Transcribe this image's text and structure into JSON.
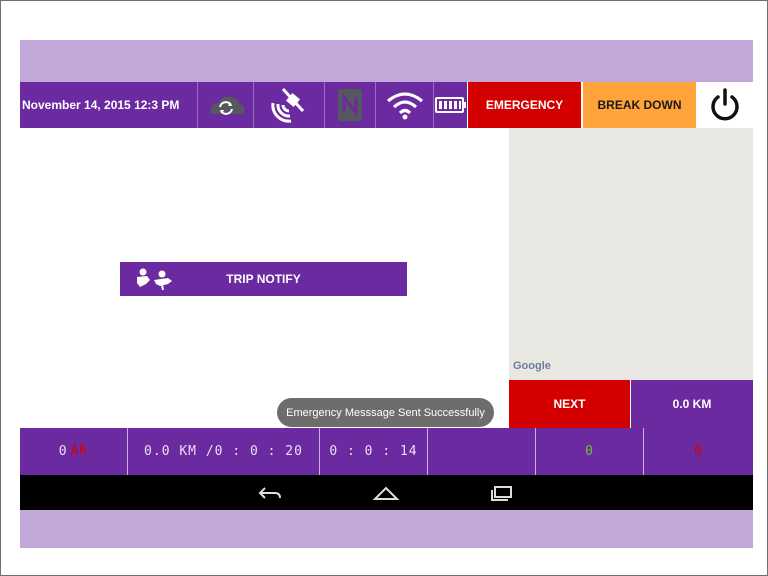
{
  "header": {
    "datetime": "November 14, 2015 12:3 PM",
    "icons": [
      "sync-icon",
      "satellite-icon",
      "nfc-icon",
      "wifi-icon",
      "battery-icon"
    ],
    "emergency_label": "EMERGENCY",
    "breakdown_label": "BREAK DOWN",
    "power_icon": "power-icon"
  },
  "map": {
    "attribution": "Google"
  },
  "trip": {
    "label": "TRIP NOTIFY",
    "icon": "trip-notify-icon"
  },
  "actions": {
    "next_label": "NEXT",
    "distance_label": "0.0 KM"
  },
  "toast": {
    "message": "Emergency Messsage Sent Successfully"
  },
  "status": {
    "cell1_value": "0",
    "cell1_unit": "AR",
    "cell2": "0.0 KM /0 : 0 : 20",
    "cell3": "0 : 0 : 14",
    "cell4": "",
    "cell5": "0",
    "cell6": "0"
  },
  "colors": {
    "purple": "#6c2aa0",
    "emergency_red": "#d40000",
    "breakdown_orange": "#ffa33a",
    "lavender": "#c2a8d8",
    "status_green": "#6fbf3a",
    "status_red": "#d40000"
  },
  "navigation": {
    "icons": [
      "back-icon",
      "home-icon",
      "recent-apps-icon"
    ]
  }
}
